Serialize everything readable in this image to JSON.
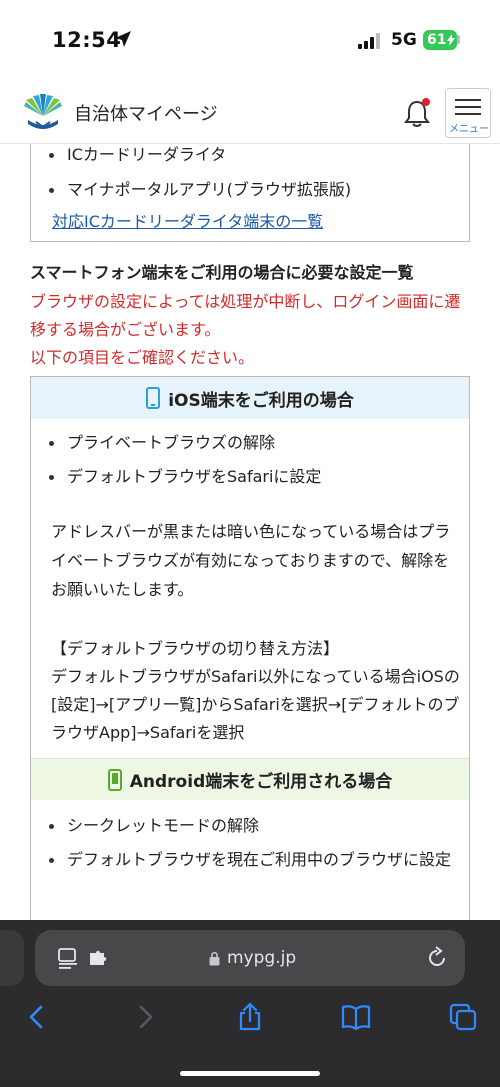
{
  "status": {
    "time": "12:54",
    "network": "5G",
    "battery": "61"
  },
  "header": {
    "site_title": "自治体マイページ",
    "menu_label": "メニュー",
    "notification_dot_color": "#e0242b",
    "accent_color": "#2a74d6"
  },
  "reader_list": {
    "items": [
      "ICカードリーダライタ",
      "マイナポータルアプリ(ブラウザ拡張版)"
    ],
    "link": "対応ICカードリーダライタ端末の一覧"
  },
  "smartphone": {
    "title": "スマートフォン端末をご利用の場合に必要な設定一覧",
    "warning": "ブラウザの設定によっては処理が中断し、ログイン画面に遷移する場合がございます。\n以下の項目をご確認ください。",
    "warning_color": "#d22b2b",
    "ios": {
      "heading": "iOS端末をご利用の場合",
      "items": [
        "プライベートブラウズの解除",
        "デフォルトブラウザをSafariに設定"
      ],
      "paragraph1": "アドレスバーが黒または暗い色になっている場合はプライベートブラウズが有効になっておりますので、解除をお願いいたします。",
      "paragraph2_heading": "【デフォルトブラウザの切り替え方法】",
      "paragraph2": "デフォルトブラウザがSafari以外になっている場合iOSの[設定]→[アプリ一覧]からSafariを選択→[デフォルトのブラウザApp]→Safariを選択"
    },
    "android": {
      "heading": "Android端末をご利用される場合",
      "items": [
        "シークレットモードの解除",
        "デフォルトブラウザを現在ご利用中のブラウザに設定"
      ]
    }
  },
  "browser": {
    "url": "mypg.jp"
  }
}
